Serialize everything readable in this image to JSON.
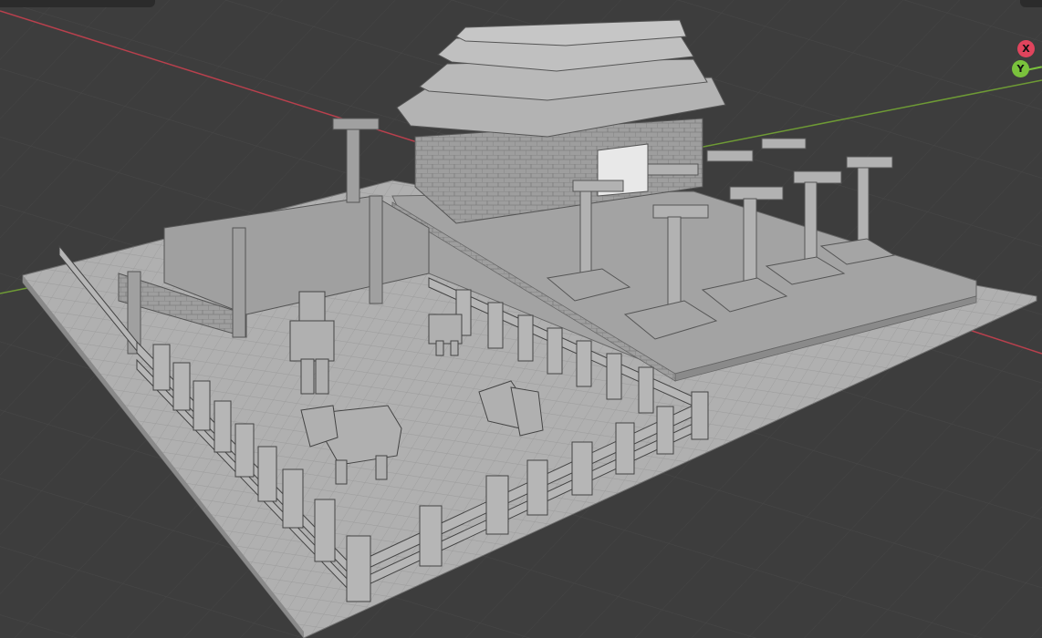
{
  "viewport": {
    "title": "",
    "background": "#3d3d3d",
    "grid_color": "#4a4a4a",
    "x_axis_color": "#b8404d",
    "y_axis_color": "#6e9a35",
    "model_color": "#a9a9a9",
    "model_edge_color": "#5a5a5a"
  },
  "gizmo": {
    "x_label": "X",
    "y_label": "Y",
    "x_color": "#e0445d",
    "y_color": "#7ac23c",
    "x_icon": "axis-x-icon",
    "y_icon": "axis-y-icon"
  }
}
